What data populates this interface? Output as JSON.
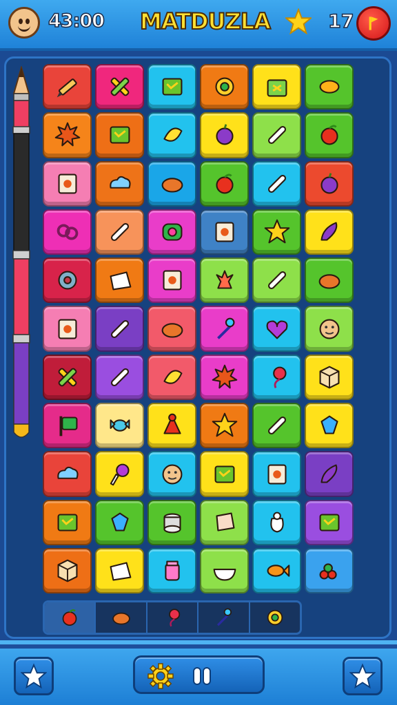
{
  "header": {
    "timer": "43:00",
    "title": "MATDUZLA",
    "score": "17",
    "avatar_icon": "smiley-face-icon",
    "star_icon": "star-icon",
    "flag_icon": "flag-icon"
  },
  "colors": {
    "bar_blue": "#2a95e8",
    "board_bg": "#16427f",
    "title_yellow": "#ffe033"
  },
  "board": {
    "columns": 6,
    "rows": 11,
    "tiles": [
      {
        "color": "#e9443a",
        "icon": "pencil"
      },
      {
        "color": "#f0277d",
        "icon": "cross"
      },
      {
        "color": "#22c2ee",
        "icon": "box"
      },
      {
        "color": "#f07a14",
        "icon": "swirl"
      },
      {
        "color": "#ffe11a",
        "icon": "gift"
      },
      {
        "color": "#55c42c",
        "icon": "leaf"
      },
      {
        "color": "#f5841a",
        "icon": "burst"
      },
      {
        "color": "#ee6f16",
        "icon": "box"
      },
      {
        "color": "#22c2ee",
        "icon": "banana"
      },
      {
        "color": "#ffe11a",
        "icon": "plum"
      },
      {
        "color": "#8ee04a",
        "icon": "pen"
      },
      {
        "color": "#55c42c",
        "icon": "apple"
      },
      {
        "color": "#f57eb3",
        "icon": "card"
      },
      {
        "color": "#ee7318",
        "icon": "cloud"
      },
      {
        "color": "#1aa6e8",
        "icon": "bean"
      },
      {
        "color": "#55c42c",
        "icon": "apple"
      },
      {
        "color": "#22c2ee",
        "icon": "pen"
      },
      {
        "color": "#ec4a2e",
        "icon": "plum"
      },
      {
        "color": "#ee2fb5",
        "icon": "pretzel"
      },
      {
        "color": "#f7935a",
        "icon": "pen"
      },
      {
        "color": "#e93dc9",
        "icon": "roll"
      },
      {
        "color": "#3f82c6",
        "icon": "card"
      },
      {
        "color": "#55c42c",
        "icon": "star"
      },
      {
        "color": "#ffe11a",
        "icon": "pepper"
      },
      {
        "color": "#d8234a",
        "icon": "donut"
      },
      {
        "color": "#f07a14",
        "icon": "bag"
      },
      {
        "color": "#e93dc9",
        "icon": "card"
      },
      {
        "color": "#8ee04a",
        "icon": "coral"
      },
      {
        "color": "#8ee04a",
        "icon": "pen"
      },
      {
        "color": "#55c42c",
        "icon": "bean"
      },
      {
        "color": "#f57eb3",
        "icon": "card"
      },
      {
        "color": "#7a3fc4",
        "icon": "pen"
      },
      {
        "color": "#f25a6a",
        "icon": "bean"
      },
      {
        "color": "#e93dc9",
        "icon": "pin"
      },
      {
        "color": "#22c2ee",
        "icon": "heart"
      },
      {
        "color": "#8ee04a",
        "icon": "face"
      },
      {
        "color": "#c01d3a",
        "icon": "cross"
      },
      {
        "color": "#9a4ee0",
        "icon": "pen"
      },
      {
        "color": "#f25a6a",
        "icon": "banana"
      },
      {
        "color": "#e93dc9",
        "icon": "burst"
      },
      {
        "color": "#22c2ee",
        "icon": "balloon"
      },
      {
        "color": "#ffe11a",
        "icon": "cube"
      },
      {
        "color": "#e52b8a",
        "icon": "flag"
      },
      {
        "color": "#ffe78a",
        "icon": "candy"
      },
      {
        "color": "#ffe11a",
        "icon": "cone"
      },
      {
        "color": "#f07a14",
        "icon": "star"
      },
      {
        "color": "#55c42c",
        "icon": "pen"
      },
      {
        "color": "#ffe11a",
        "icon": "gem"
      },
      {
        "color": "#e9443a",
        "icon": "cloud"
      },
      {
        "color": "#ffe11a",
        "icon": "lollipop"
      },
      {
        "color": "#22c2ee",
        "icon": "face"
      },
      {
        "color": "#ffe11a",
        "icon": "box"
      },
      {
        "color": "#22c2ee",
        "icon": "card"
      },
      {
        "color": "#7a3fc4",
        "icon": "pepper"
      },
      {
        "color": "#f07a14",
        "icon": "box"
      },
      {
        "color": "#55c42c",
        "icon": "gem"
      },
      {
        "color": "#55c42c",
        "icon": "stack"
      },
      {
        "color": "#8ee04a",
        "icon": "paper"
      },
      {
        "color": "#22c2ee",
        "icon": "sack"
      },
      {
        "color": "#9a4ee0",
        "icon": "box"
      },
      {
        "color": "#ee6f16",
        "icon": "cube"
      },
      {
        "color": "#ffe11a",
        "icon": "bag"
      },
      {
        "color": "#22c2ee",
        "icon": "jar"
      },
      {
        "color": "#8ee04a",
        "icon": "bowl"
      },
      {
        "color": "#22c2ee",
        "icon": "fish"
      },
      {
        "color": "#3aa2ee",
        "icon": "berries"
      }
    ]
  },
  "tray": {
    "slots": [
      "apple",
      "bean",
      "balloon",
      "pin",
      "swirl"
    ]
  },
  "footer": {
    "left_icon": "star-icon",
    "center_left_icon": "gear-icon",
    "center_right_icon": "pause-icon",
    "right_icon": "star-icon"
  }
}
